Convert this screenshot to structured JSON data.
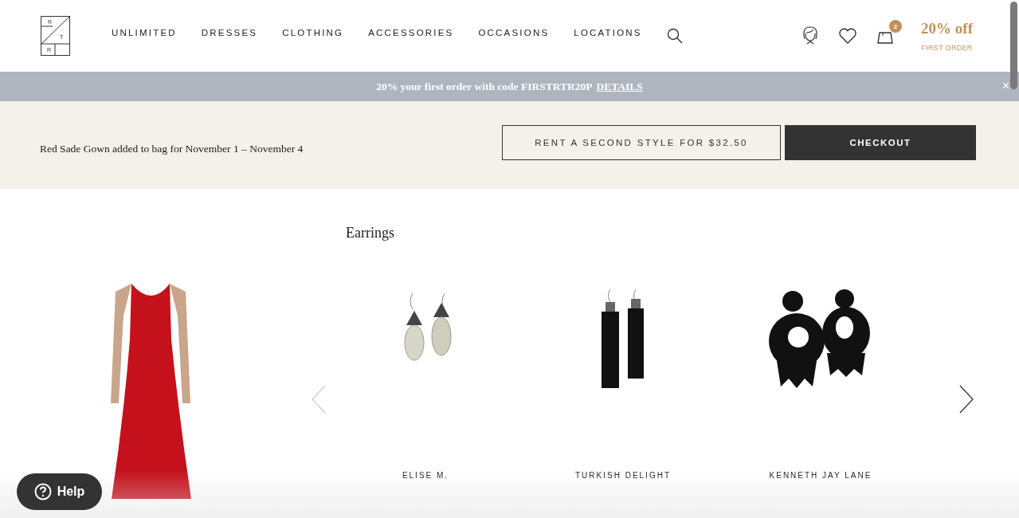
{
  "logo": {
    "letters": [
      "R",
      "T",
      "R"
    ]
  },
  "nav": {
    "items": [
      "UNLIMITED",
      "DRESSES",
      "CLOTHING",
      "ACCESSORIES",
      "OCCASIONS",
      "LOCATIONS"
    ]
  },
  "account": {
    "bag_count": "2",
    "offer_title": "20% off",
    "offer_subtitle": "FIRST ORDER"
  },
  "promo_bar": {
    "text": "20% your first order with code FIRSTRTR20P",
    "link": "DETAILS",
    "close": "×"
  },
  "bag_notice": {
    "message": "Red Sade Gown added to bag for November 1 – November 4",
    "secondary_button": "RENT A SECOND STYLE FOR $32.50",
    "primary_button": "CHECKOUT"
  },
  "section": {
    "title": "Earrings"
  },
  "products": [
    {
      "kind": "drop",
      "brand": "ELISE M."
    },
    {
      "kind": "tassel",
      "brand": "TURKISH DELIGHT"
    },
    {
      "kind": "beaded",
      "brand": "KENNETH JAY LANE"
    }
  ],
  "help": {
    "label": "Help"
  }
}
